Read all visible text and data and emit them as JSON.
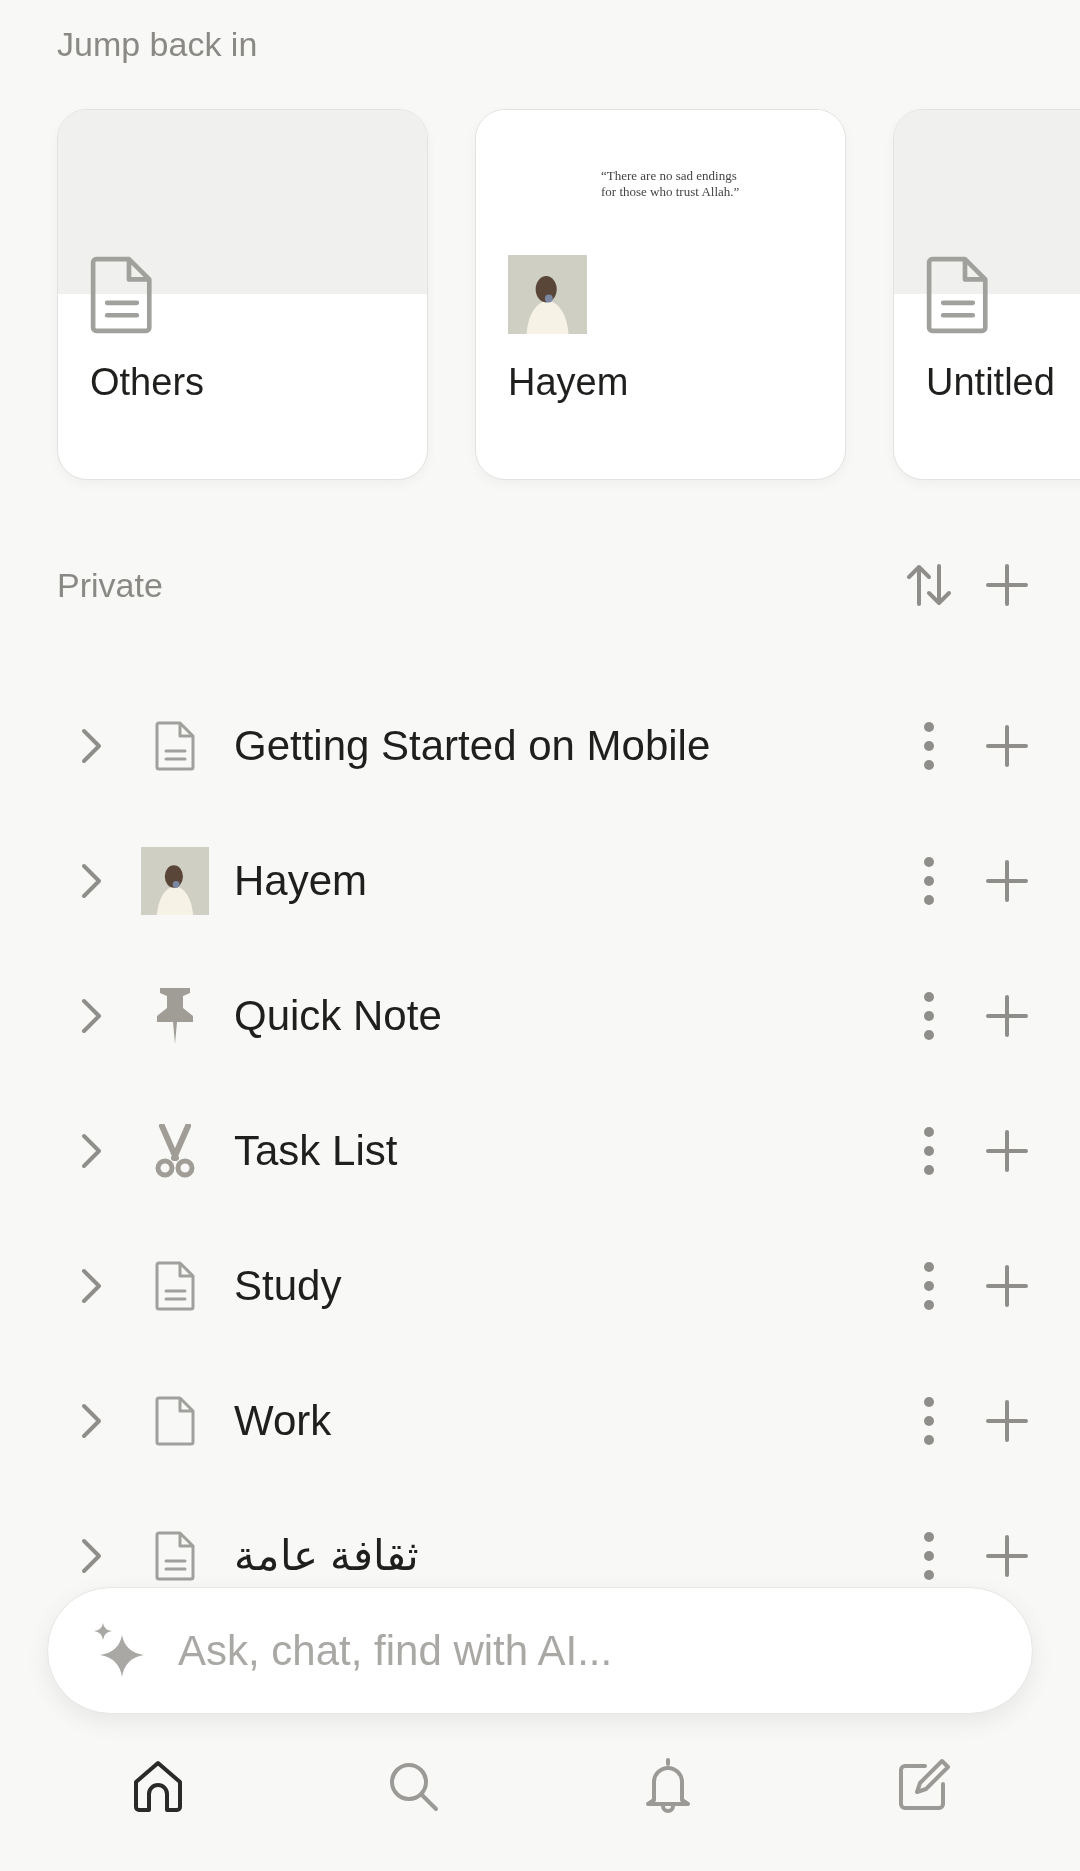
{
  "section_title": "Jump back in",
  "cards": [
    {
      "title": "Others",
      "kind": "doc"
    },
    {
      "title": "Hayem",
      "kind": "picture",
      "preview": "“There are no sad endings for those who trust Allah.”"
    },
    {
      "title": "Untitled",
      "kind": "doc"
    }
  ],
  "private": {
    "title": "Private",
    "pages": [
      {
        "title": "Getting Started on Mobile",
        "kind": "doc"
      },
      {
        "title": "Hayem",
        "kind": "picture"
      },
      {
        "title": "Quick Note",
        "kind": "pin"
      },
      {
        "title": "Task List",
        "kind": "scissors"
      },
      {
        "title": "Study",
        "kind": "doc"
      },
      {
        "title": "Work",
        "kind": "blank"
      },
      {
        "title": "ثقافة عامة",
        "kind": "doc"
      }
    ]
  },
  "ai_bar": {
    "placeholder": "Ask, chat, find with AI..."
  },
  "nav": [
    {
      "kind": "home",
      "selected": true
    },
    {
      "kind": "search",
      "selected": false
    },
    {
      "kind": "bell",
      "selected": false
    },
    {
      "kind": "compose",
      "selected": false
    }
  ]
}
